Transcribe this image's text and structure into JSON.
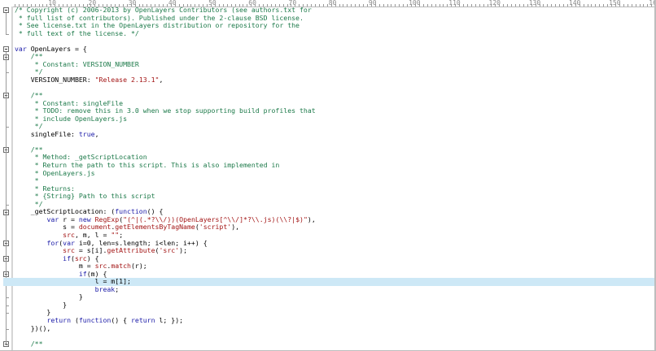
{
  "ruler": {
    "labels": [
      "10",
      "20",
      "30",
      "40",
      "50",
      "60",
      "70",
      "80",
      "90",
      "100",
      "110",
      "120",
      "130",
      "140",
      "150",
      "160"
    ]
  },
  "code_lines": [
    "/* Copyright (c) 2006-2013 by OpenLayers Contributors (see authors.txt for",
    " * full list of contributors). Published under the 2-clause BSD license.",
    " * See license.txt in the OpenLayers distribution or repository for the",
    " * full text of the license. */",
    "",
    "var OpenLayers = {",
    "    /**",
    "     * Constant: VERSION_NUMBER",
    "     */",
    "    VERSION_NUMBER: \"Release 2.13.1\",",
    "",
    "    /**",
    "     * Constant: singleFile",
    "     * TODO: remove this in 3.0 when we stop supporting build profiles that",
    "     * include OpenLayers.js",
    "     */",
    "    singleFile: true,",
    "",
    "    /**",
    "     * Method: _getScriptLocation",
    "     * Return the path to this script. This is also implemented in",
    "     * OpenLayers.js",
    "     *",
    "     * Returns:",
    "     * {String} Path to this script",
    "     */",
    "    _getScriptLocation: (function() {",
    "        var r = new RegExp(\"(^|(.*?\\\\/))(OpenLayers[^\\\\/]*?\\\\.js)(\\\\?|$)\"),",
    "            s = document.getElementsByTagName('script'),",
    "            src, m, l = \"\";",
    "        for(var i=0, len=s.length; i<len; i++) {",
    "            src = s[i].getAttribute('src');",
    "            if(src) {",
    "                m = src.match(r);",
    "                if(m) {",
    "                    l = m[1];",
    "                    break;",
    "                }",
    "            }",
    "        }",
    "        return (function() { return l; });",
    "    })(),",
    "",
    "    /**"
  ],
  "colors": {
    "comment": "#1d7a4a",
    "keyword": "#1b1ba8",
    "string": "#a31515",
    "highlight": "#cde8f6"
  },
  "highlighted_line": 35
}
